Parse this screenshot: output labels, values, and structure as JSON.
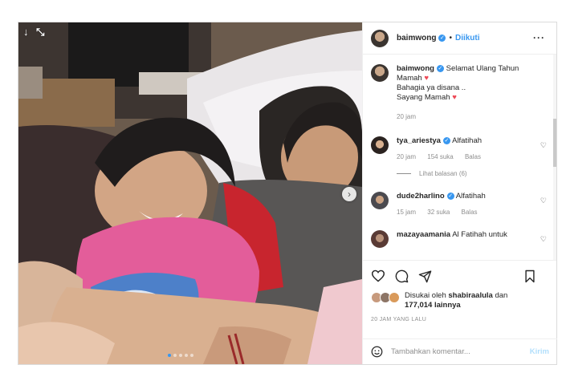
{
  "post": {
    "username": "baimwong",
    "follow_status": "Diikuti",
    "caption_lines": [
      "Selamat Ulang Tahun Mamah",
      "Bahagia ya disana ..",
      "Sayang Mamah"
    ],
    "caption_time": "20 jam"
  },
  "comments": [
    {
      "user": "tya_ariestya",
      "verified": true,
      "text": "Alfatihah",
      "time": "20 jam",
      "likes": "154 suka",
      "reply": "Balas",
      "view_replies": "Lihat balasan (6)"
    },
    {
      "user": "dude2harlino",
      "verified": true,
      "text": "Alfatihah",
      "time": "15 jam",
      "likes": "32 suka",
      "reply": "Balas"
    },
    {
      "user": "mazayaamania",
      "verified": false,
      "text": "Al Fatihah untuk"
    }
  ],
  "likes_info": {
    "prefix": "Disukai oleh",
    "user": "shabiraalula",
    "connector": "dan",
    "count": "177,014",
    "suffix": "lainnya"
  },
  "time_ago": "20 JAM YANG LALU",
  "add_comment": {
    "placeholder": "Tambahkan komentar...",
    "post_label": "Kirim"
  },
  "icons": [
    "more-icon",
    "verified-icon",
    "heart-icon",
    "comment-icon",
    "share-icon",
    "bookmark-icon",
    "emoji-icon",
    "next-arrow-icon"
  ],
  "colors": {
    "accent": "#3897f0",
    "red": "#ed4956",
    "muted": "#8e8e8e"
  },
  "carousel": {
    "total": 5,
    "active": 0
  }
}
